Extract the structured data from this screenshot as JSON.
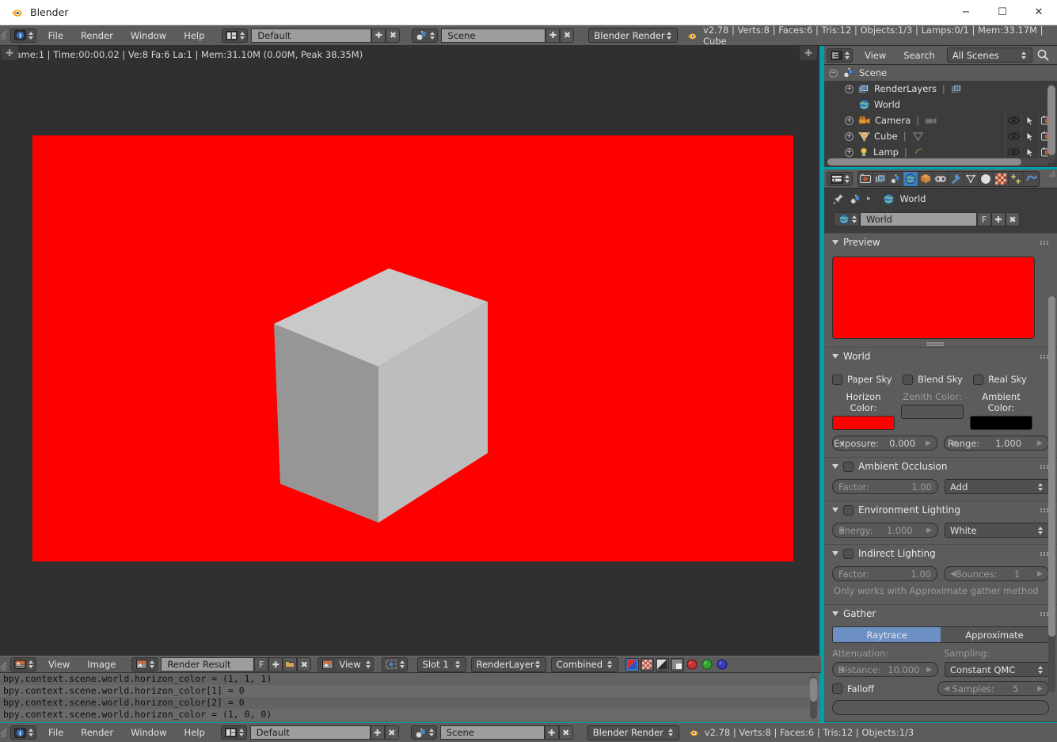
{
  "window": {
    "title": "Blender",
    "app_icon": "blender-logo-icon",
    "minimize": "−",
    "maximize": "☐",
    "close": "✕"
  },
  "topbar": {
    "editor_icon": "info-editor-icon",
    "menus": [
      "File",
      "Render",
      "Window",
      "Help"
    ],
    "screen_layout": {
      "icon": "screen-layout-icon",
      "value": "Default",
      "add": "✚",
      "remove": "✖"
    },
    "scene": {
      "icon": "scene-icon",
      "value": "Scene",
      "add": "✚",
      "remove": "✖"
    },
    "engine": {
      "value": "Blender Render"
    },
    "version_icon": "blender-logo-icon",
    "stats": "v2.78 | Verts:8 | Faces:6 | Tris:12 | Objects:1/3 | Lamps:0/1 | Mem:33.17M | Cube"
  },
  "image_editor": {
    "render_status": "Frame:1 | Time:00:00.02 | Ve:8 Fa:6 La:1 | Mem:31.10M (0.00M, Peak 38.35M)",
    "tab_plus_left": "✚",
    "tab_plus_right": "✚",
    "render": {
      "background_color": "#ff0000",
      "cube_top_color": "#c9c9c9",
      "cube_left_color": "#969696",
      "cube_right_color": "#bdbdbd"
    },
    "footer": {
      "editor_icon": "image-editor-icon",
      "menus": [
        "View",
        "Image"
      ],
      "image_datablock": {
        "icon": "image-icon",
        "value": "Render Result",
        "fake_user": "F",
        "add": "✚",
        "open": "open-folder-icon",
        "unlink": "✖"
      },
      "view_mode": {
        "icon": "image-icon",
        "value": "View"
      },
      "pivot": {
        "icon": "pivot-icon"
      },
      "slot": {
        "value": "Slot 1"
      },
      "render_layer": {
        "value": "RenderLayer"
      },
      "pass": {
        "value": "Combined"
      },
      "display_buttons": [
        "color-and-alpha-icon",
        "alpha-icon",
        "zdepth-icon",
        "render-preview-icon"
      ],
      "channel_buttons": [
        "red-channel-icon",
        "green-channel-icon",
        "blue-channel-icon"
      ]
    }
  },
  "console": {
    "lines": [
      "bpy.context.scene.world.horizon_color = (1, 1, 1)",
      "bpy.context.scene.world.horizon_color[1] = 0",
      "bpy.context.scene.world.horizon_color[2] = 0",
      "bpy.context.scene.world.horizon_color = (1, 0, 0)"
    ]
  },
  "bottombar": {
    "editor_icon": "info-editor-icon",
    "menus": [
      "File",
      "Render",
      "Window",
      "Help"
    ],
    "screen_layout": {
      "icon": "screen-layout-icon",
      "value": "Default",
      "add": "✚",
      "remove": "✖"
    },
    "scene": {
      "icon": "scene-icon",
      "value": "Scene",
      "add": "✚",
      "remove": "✖"
    },
    "engine": {
      "value": "Blender Render"
    },
    "version_icon": "blender-logo-icon",
    "stats": "v2.78 | Verts:8 | Faces:6 | Tris:12 | Objects:1/3"
  },
  "outliner": {
    "editor_icon": "outliner-editor-icon",
    "menus": [
      "View",
      "Search"
    ],
    "display_mode": "All Scenes",
    "search_icon": "magnifier-icon",
    "rows": [
      {
        "label": "Scene",
        "icon": "scene-icon",
        "indent": 0,
        "expander": "−",
        "selected": true,
        "datablock": null,
        "has_toggles": false
      },
      {
        "label": "RenderLayers",
        "icon": "renderlayers-icon",
        "indent": 1,
        "expander": "+",
        "datablock": "renderlayers-icon",
        "has_toggles": false
      },
      {
        "label": "World",
        "icon": "world-icon",
        "indent": 1,
        "expander": "",
        "datablock": null,
        "has_toggles": false
      },
      {
        "label": "Camera",
        "icon": "camera-object-icon",
        "indent": 1,
        "expander": "+",
        "datablock": "camera-data-icon",
        "has_toggles": true
      },
      {
        "label": "Cube",
        "icon": "mesh-object-icon",
        "indent": 1,
        "expander": "+",
        "datablock": "mesh-data-icon",
        "has_toggles": true
      },
      {
        "label": "Lamp",
        "icon": "lamp-object-icon",
        "indent": 1,
        "expander": "+",
        "datablock": "lamp-data-icon",
        "has_toggles": true
      }
    ],
    "toggle_icons": [
      "eye-icon",
      "cursor-arrow-icon",
      "camera-render-icon"
    ]
  },
  "properties": {
    "editor_icon": "properties-editor-icon",
    "tabs": [
      {
        "name": "render-tab",
        "icon": "camera-back-icon",
        "active": false
      },
      {
        "name": "render-layers-tab",
        "icon": "renderlayers-icon",
        "active": false
      },
      {
        "name": "scene-tab",
        "icon": "scene-icon",
        "active": false
      },
      {
        "name": "world-tab",
        "icon": "world-icon",
        "active": true
      },
      {
        "name": "object-tab",
        "icon": "cube-icon",
        "active": false
      },
      {
        "name": "constraints-tab",
        "icon": "chain-icon",
        "active": false
      },
      {
        "name": "modifiers-tab",
        "icon": "wrench-icon",
        "active": false
      },
      {
        "name": "object-data-tab",
        "icon": "mesh-data-icon",
        "active": false
      },
      {
        "name": "material-tab",
        "icon": "material-sphere-icon",
        "active": false
      },
      {
        "name": "texture-tab",
        "icon": "checker-icon",
        "active": false
      },
      {
        "name": "particles-tab",
        "icon": "particles-icon",
        "active": false
      },
      {
        "name": "physics-tab",
        "icon": "physics-icon",
        "active": false
      }
    ],
    "breadcrumb": {
      "pin_icon": "pin-icon",
      "scene_icon": "scene-icon",
      "sep": "▸",
      "world_icon": "world-icon",
      "world_label": "World"
    },
    "id_block": {
      "icon": "world-icon",
      "value": "World",
      "fake_user": "F",
      "add": "✚",
      "unlink": "✖"
    },
    "panels": {
      "preview": {
        "title": "Preview",
        "color": "#ff0000"
      },
      "world": {
        "title": "World",
        "checkboxes": [
          {
            "label": "Paper Sky",
            "checked": false
          },
          {
            "label": "Blend Sky",
            "checked": false
          },
          {
            "label": "Real Sky",
            "checked": false
          }
        ],
        "colors": [
          {
            "label": "Horizon Color:",
            "value": "#ff0000",
            "enabled": true
          },
          {
            "label": "Zenith Color:",
            "value": "#555555",
            "enabled": false
          },
          {
            "label": "Ambient Color:",
            "value": "#000000",
            "enabled": true
          }
        ],
        "exposure": {
          "label": "Exposure:",
          "value": "0.000"
        },
        "range": {
          "label": "Range:",
          "value": "1.000"
        }
      },
      "ambient_occlusion": {
        "title": "Ambient Occlusion",
        "enabled": false,
        "factor": {
          "label": "Factor:",
          "value": "1.00"
        },
        "blend_mode": "Add"
      },
      "environment_lighting": {
        "title": "Environment Lighting",
        "enabled": false,
        "energy": {
          "label": "Energy:",
          "value": "1.000"
        },
        "color": "White"
      },
      "indirect_lighting": {
        "title": "Indirect Lighting",
        "enabled": false,
        "factor": {
          "label": "Factor:",
          "value": "1.00"
        },
        "bounces": {
          "label": "Bounces:",
          "value": "1"
        },
        "note": "Only works with Approximate gather method"
      },
      "gather": {
        "title": "Gather",
        "methods": [
          {
            "label": "Raytrace",
            "active": true
          },
          {
            "label": "Approximate",
            "active": false
          }
        ],
        "attenuation_label": "Attenuation:",
        "sampling_label": "Sampling:",
        "distance": {
          "label": "Distance:",
          "value": "10.000"
        },
        "sampling_method": "Constant QMC",
        "falloff": {
          "label": "Falloff",
          "checked": false
        },
        "samples": {
          "label": "Samples:",
          "value": "5"
        }
      }
    }
  }
}
